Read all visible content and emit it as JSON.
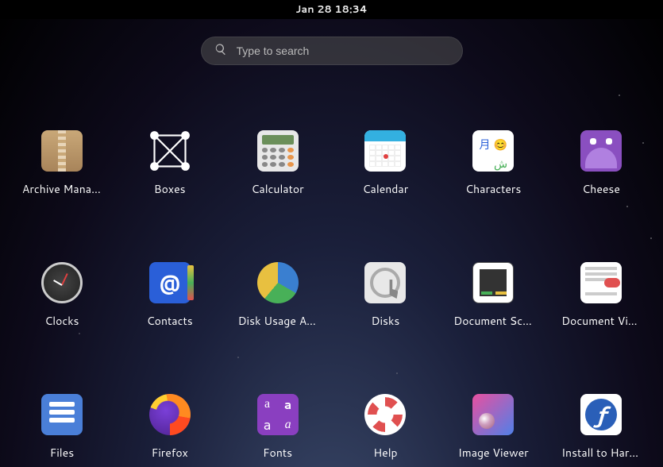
{
  "topbar": {
    "datetime": "Jan 28  18:34"
  },
  "search": {
    "placeholder": "Type to search"
  },
  "apps": [
    {
      "id": "archive-manager",
      "label": "Archive Manager"
    },
    {
      "id": "boxes",
      "label": "Boxes"
    },
    {
      "id": "calculator",
      "label": "Calculator"
    },
    {
      "id": "calendar",
      "label": "Calendar"
    },
    {
      "id": "characters",
      "label": "Characters"
    },
    {
      "id": "cheese",
      "label": "Cheese"
    },
    {
      "id": "clocks",
      "label": "Clocks"
    },
    {
      "id": "contacts",
      "label": "Contacts"
    },
    {
      "id": "disk-usage",
      "label": "Disk Usage Analyzer"
    },
    {
      "id": "disks",
      "label": "Disks"
    },
    {
      "id": "document-scanner",
      "label": "Document Scanner"
    },
    {
      "id": "document-viewer",
      "label": "Document Viewer"
    },
    {
      "id": "files",
      "label": "Files"
    },
    {
      "id": "firefox",
      "label": "Firefox"
    },
    {
      "id": "fonts",
      "label": "Fonts"
    },
    {
      "id": "help",
      "label": "Help"
    },
    {
      "id": "image-viewer",
      "label": "Image Viewer"
    },
    {
      "id": "install-to-hd",
      "label": "Install to Hard Drive"
    }
  ]
}
